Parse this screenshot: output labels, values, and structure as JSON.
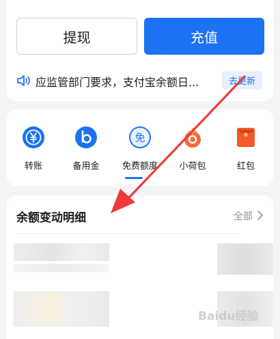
{
  "actions": {
    "withdraw_label": "提现",
    "recharge_label": "充值"
  },
  "notice": {
    "text": "应监管部门要求，支付宝余额日...",
    "button": "去更新"
  },
  "services": [
    {
      "label": "转账",
      "icon": "transfer-yuan-icon"
    },
    {
      "label": "备用金",
      "icon": "reserve-fund-icon"
    },
    {
      "label": "免费额度",
      "icon": "free-quota-icon"
    },
    {
      "label": "小荷包",
      "icon": "small-pouch-icon"
    },
    {
      "label": "红包",
      "icon": "red-packet-icon"
    }
  ],
  "services_icon_text": {
    "free": "免"
  },
  "balance": {
    "title": "余额变动明细",
    "all": "全部"
  },
  "watermark": {
    "text": "Baidu经验"
  },
  "colors": {
    "accent": "#1b72f2",
    "annotation_arrow": "#f03a3a"
  }
}
